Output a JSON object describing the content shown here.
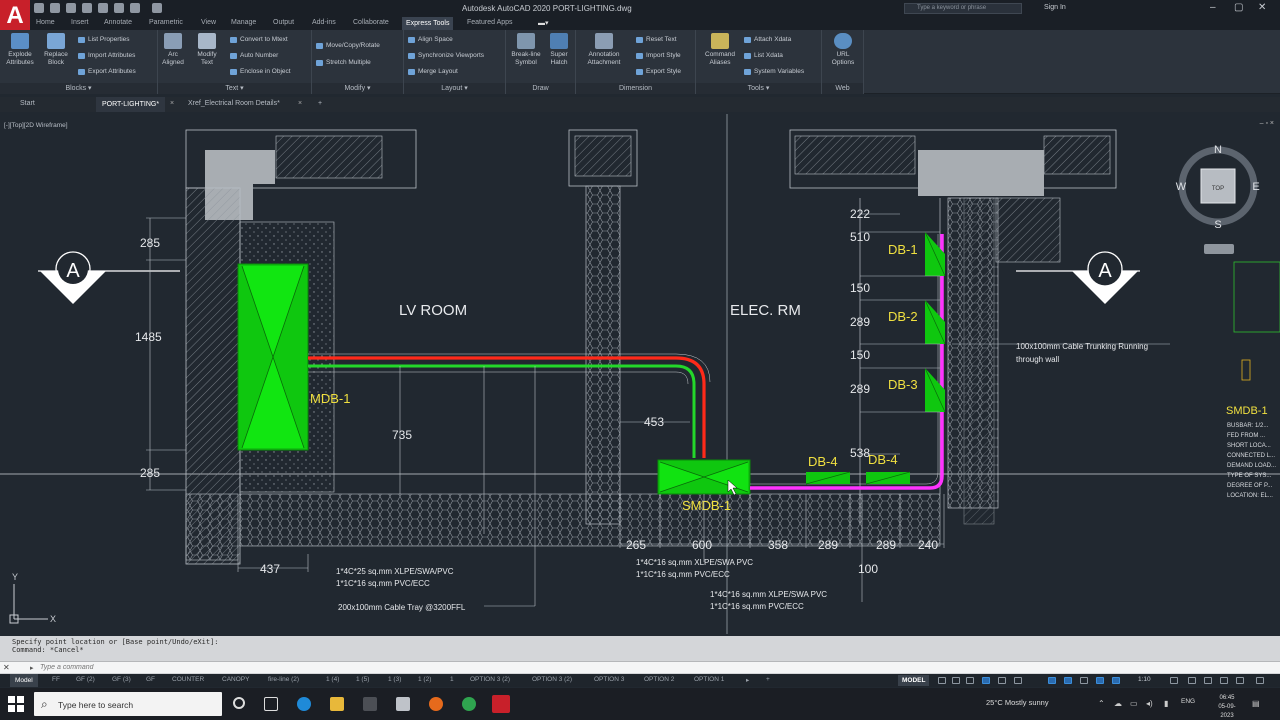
{
  "app": {
    "logo": "A",
    "window_title": "Autodesk AutoCAD 2020    PORT-LIGHTING.dwg",
    "search_placeholder": "Type a keyword or phrase",
    "signin": "Sign In"
  },
  "ribbon_tabs": [
    "Home",
    "Insert",
    "Annotate",
    "Parametric",
    "View",
    "Manage",
    "Output",
    "Add-ins",
    "Collaborate",
    "Express Tools",
    "Featured Apps"
  ],
  "active_ribbon_tab": "Express Tools",
  "ribbon": {
    "blocks": {
      "title": "Blocks ▾",
      "big": [
        {
          "label": "Explode\nAttributes"
        },
        {
          "label": "Replace\nBlock"
        }
      ],
      "small": [
        "List Properties",
        "Import Attributes",
        "Export Attributes"
      ]
    },
    "text": {
      "title": "Text ▾",
      "big": [
        {
          "label": "Arc\nAligned"
        },
        {
          "label": "Modify\nText"
        }
      ],
      "small": [
        "Convert to Mtext",
        "Auto Number",
        "Enclose in Object"
      ]
    },
    "modify": {
      "title": "Modify ▾",
      "small": [
        "Move/Copy/Rotate",
        "Stretch Multiple"
      ]
    },
    "layout": {
      "title": "Layout ▾",
      "small": [
        "Align Space",
        "Synchronize Viewports",
        "Merge Layout"
      ]
    },
    "draw": {
      "title": "Draw",
      "big": [
        {
          "label": "Break-line\nSymbol"
        },
        {
          "label": "Super\nHatch"
        }
      ]
    },
    "dimension": {
      "title": "Dimension",
      "big": [
        {
          "label": "Annotation\nAttachment"
        }
      ],
      "small": [
        "Reset Text",
        "Import Style",
        "Export Style"
      ]
    },
    "tools": {
      "title": "Tools ▾",
      "big": [
        {
          "label": "Command\nAliases"
        }
      ],
      "small": [
        "Attach Xdata",
        "List Xdata",
        "System Variables"
      ]
    },
    "web": {
      "title": "Web",
      "big": [
        {
          "label": "URL\nOptions"
        }
      ]
    }
  },
  "doc_tabs": [
    "Start",
    "PORT-LIGHTING*",
    "Xref_Electrical Room Details*"
  ],
  "active_doc_tab": "PORT-LIGHTING*",
  "viewport": {
    "label": "[-][Top][2D Wireframe]",
    "controls": "–  ▫  ×"
  },
  "viewcube": {
    "n": "N",
    "s": "S",
    "e": "E",
    "w": "W",
    "top": "TOP"
  },
  "drawing": {
    "rooms": {
      "lv": "LV ROOM",
      "elec": "ELEC. RM"
    },
    "section_marker": "A",
    "equipment": {
      "mdb": "MDB-1",
      "smdb": "SMDB-1",
      "db1": "DB-1",
      "db2": "DB-2",
      "db3": "DB-3",
      "db4a": "DB-4",
      "db4b": "DB-4",
      "smdb_right": "SMDB-1"
    },
    "dims": {
      "d285_top": "285",
      "d1485": "1485",
      "d285_bot": "285",
      "d437": "437",
      "d735": "735",
      "d453": "453",
      "d265": "265",
      "d600": "600",
      "d358": "358",
      "d289a": "289",
      "d289b": "289",
      "d240": "240",
      "d100": "100",
      "r222": "222",
      "r510": "510",
      "r150a": "150",
      "r289a": "289",
      "r150b": "150",
      "r289b": "289",
      "r538": "538"
    },
    "notes": {
      "lv_cable_1": "1*4C*25 sq.mm XLPE/SWA/PVC",
      "lv_cable_2": "1*1C*16 sq.mm PVC/ECC",
      "cable_tray": "200x100mm Cable Tray @3200FFL",
      "smdb_cable_1": "1*4C*16 sq.mm XLPE/SWA PVC",
      "smdb_cable_2": "1*1C*16 sq.mm PVC/ECC",
      "db_cable_1": "1*4C*16 sq.mm XLPE/SWA PVC",
      "db_cable_2": "1*1C*16 sq.mm PVC/ECC",
      "trunking_1": "100x100mm Cable Trunking Running",
      "trunking_2": "through wall"
    },
    "right_partial": [
      "BUSBAR: 1/2...",
      "FED FROM ...",
      "SHORT LOCA...",
      "CONNECTED L...",
      "DEMAND LOAD...",
      "TYPE OF SYS...",
      "DEGREE OF P...",
      "LOCATION: EL..."
    ]
  },
  "command": {
    "history_1": "Specify point location or [Base point/Undo/eXit]:",
    "history_2": "Command: *Cancel*",
    "prompt_icon": "▸",
    "placeholder": "Type a command"
  },
  "layout_tabs": [
    "Model",
    "FF",
    "GF (2)",
    "GF (3)",
    "GF",
    "COUNTER",
    "CANOPY",
    "fire-line (2)",
    "1 (4)",
    "1 (5)",
    "1 (3)",
    "1 (2)",
    "1",
    "OPTION 3 (2)",
    "OPTION 3 (2)",
    "OPTION 3",
    "OPTION 2",
    "OPTION 1"
  ],
  "active_layout_tab": "Model",
  "status": {
    "model": "MODEL",
    "zoom": "1:10"
  },
  "taskbar": {
    "search_text": "Type here to search",
    "weather": "25°C  Mostly sunny",
    "lang": "ENG",
    "time": "06:45",
    "date": "05-09-2023"
  },
  "colors": {
    "accent": "#c8202a",
    "green_equipment": "#14d414",
    "red_cable": "#ff2a1a",
    "green_cable": "#24d82a",
    "magenta_trunk": "#ff33ff",
    "yellow_text": "#f0e040"
  }
}
